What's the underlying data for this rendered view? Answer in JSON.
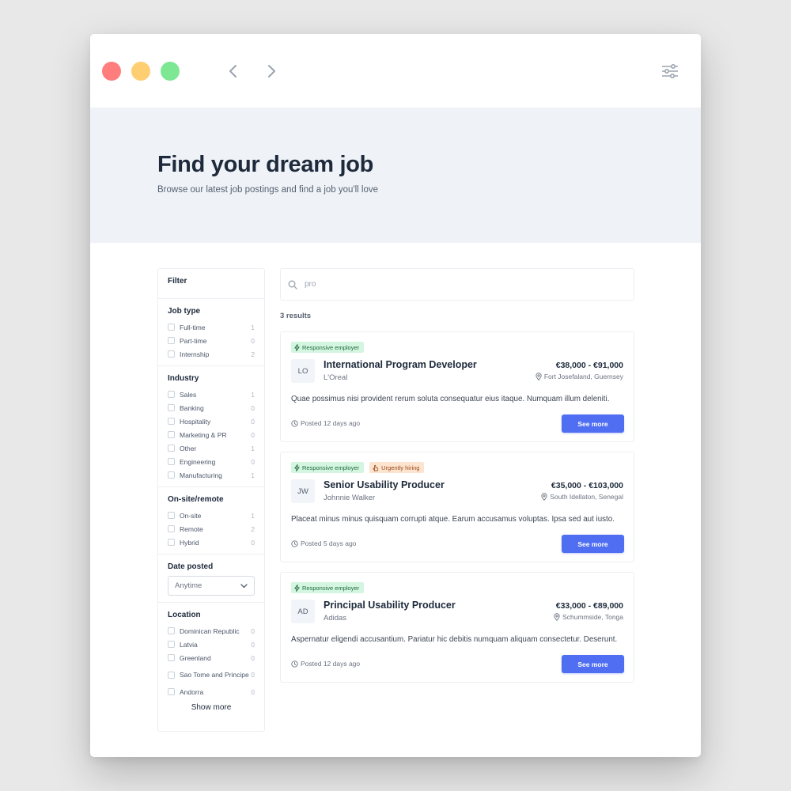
{
  "hero": {
    "title": "Find your dream job",
    "subtitle": "Browse our latest job postings and find a job you'll love"
  },
  "filter": {
    "title": "Filter",
    "job_type": {
      "title": "Job type",
      "options": [
        {
          "label": "Full-time",
          "count": "1"
        },
        {
          "label": "Part-time",
          "count": "0"
        },
        {
          "label": "Internship",
          "count": "2"
        }
      ]
    },
    "industry": {
      "title": "Industry",
      "options": [
        {
          "label": "Sales",
          "count": "1"
        },
        {
          "label": "Banking",
          "count": "0"
        },
        {
          "label": "Hospitality",
          "count": "0"
        },
        {
          "label": "Marketing & PR",
          "count": "0"
        },
        {
          "label": "Other",
          "count": "1"
        },
        {
          "label": "Engineering",
          "count": "0"
        },
        {
          "label": "Manufacturing",
          "count": "1"
        }
      ]
    },
    "onsite": {
      "title": "On-site/remote",
      "options": [
        {
          "label": "On-site",
          "count": "1"
        },
        {
          "label": "Remote",
          "count": "2"
        },
        {
          "label": "Hybrid",
          "count": "0"
        }
      ]
    },
    "date_posted": {
      "title": "Date posted",
      "selected": "Anytime"
    },
    "location": {
      "title": "Location",
      "options": [
        {
          "label": "Dominican Republic",
          "count": "0"
        },
        {
          "label": "Latvia",
          "count": "0"
        },
        {
          "label": "Greenland",
          "count": "0"
        },
        {
          "label": "Sao Tome and Principe",
          "count": "0"
        },
        {
          "label": "Andorra",
          "count": "0"
        }
      ],
      "show_more": "Show more"
    }
  },
  "search": {
    "value": "pro"
  },
  "results": {
    "count_text": "3 results",
    "jobs": [
      {
        "badges": [
          "Responsive employer"
        ],
        "logo": "LO",
        "title": "International Program Developer",
        "company": "L'Oreal",
        "salary": "€38,000 - €91,000",
        "location": "Fort Josefaland, Guernsey",
        "description": "Quae possimus nisi provident rerum soluta consequatur eius itaque. Numquam illum deleniti.",
        "posted": "Posted 12 days ago",
        "button": "See more"
      },
      {
        "badges": [
          "Responsive employer",
          "Urgently hiring"
        ],
        "logo": "JW",
        "title": "Senior Usability Producer",
        "company": "Johnnie Walker",
        "salary": "€35,000 - €103,000",
        "location": "South Idellaton, Senegal",
        "description": "Placeat minus minus quisquam corrupti atque. Earum accusamus voluptas. Ipsa sed aut iusto.",
        "posted": "Posted 5 days ago",
        "button": "See more"
      },
      {
        "badges": [
          "Responsive employer"
        ],
        "logo": "AD",
        "title": "Principal Usability Producer",
        "company": "Adidas",
        "salary": "€33,000 - €89,000",
        "location": "Schummside, Tonga",
        "description": "Aspernatur eligendi accusantium. Pariatur hic debitis numquam aliquam consectetur. Deserunt.",
        "posted": "Posted 12 days ago",
        "button": "See more"
      }
    ]
  },
  "colors": {
    "accent": "#4f6ef2",
    "hero_bg": "#eff3f8",
    "badge_green_bg": "#d4f5e0",
    "badge_orange_bg": "#fde4cf"
  },
  "icons": {
    "back": "chevron-left-icon",
    "forward": "chevron-right-icon",
    "settings": "sliders-icon",
    "search": "search-icon",
    "badge_responsive": "lightning-icon",
    "badge_urgent": "hand-icon",
    "location": "map-pin-icon",
    "posted": "clock-icon",
    "select": "chevron-down-icon"
  }
}
